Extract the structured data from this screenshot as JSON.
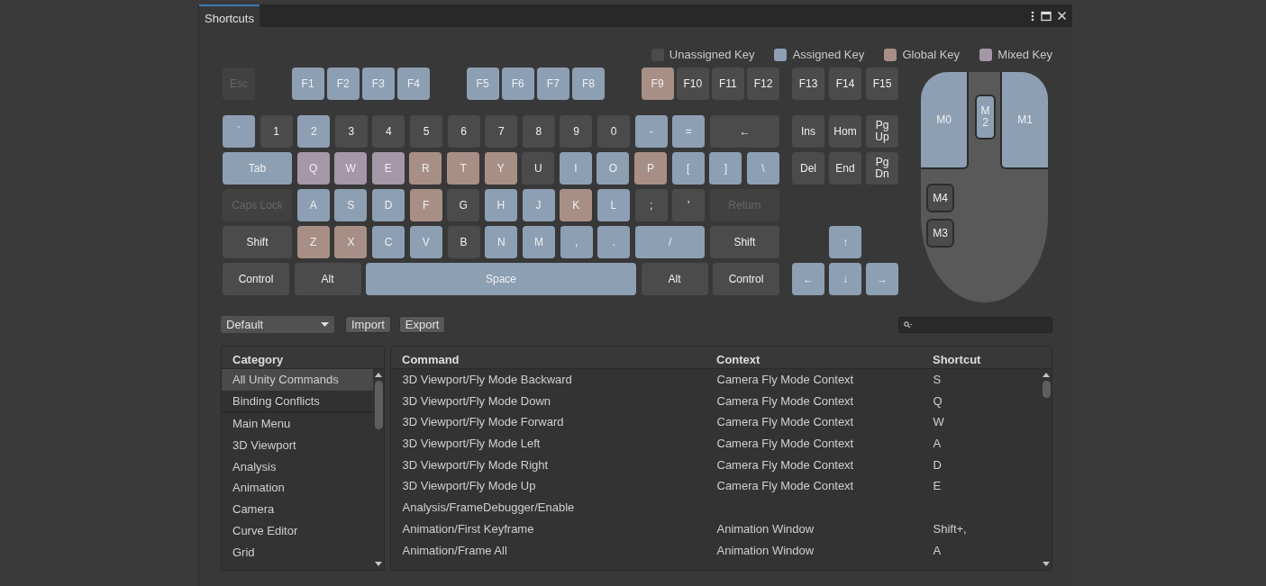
{
  "window": {
    "tab": "Shortcuts",
    "selected": true
  },
  "legend": [
    {
      "label": "Unassigned Key",
      "color": "#4b4b4b"
    },
    {
      "label": "Assigned Key",
      "color": "#8d9fb3"
    },
    {
      "label": "Global Key",
      "color": "#a88f85"
    },
    {
      "label": "Mixed Key",
      "color": "#a596a8"
    }
  ],
  "function_keys": [
    [
      {
        "label": "Esc",
        "kind": "key",
        "color": "#414141",
        "disabled": true
      }
    ],
    [
      {
        "label": "F1",
        "kind": "key",
        "color": "#8d9fb3",
        "disabled": false
      },
      {
        "label": "F2",
        "kind": "key",
        "color": "#8d9fb3",
        "disabled": false
      },
      {
        "label": "F3",
        "kind": "key",
        "color": "#8d9fb3",
        "disabled": false
      },
      {
        "label": "F4",
        "kind": "key",
        "color": "#8d9fb3",
        "disabled": false
      }
    ],
    [
      {
        "label": "F5",
        "kind": "key",
        "color": "#8d9fb3",
        "disabled": false
      },
      {
        "label": "F6",
        "kind": "key",
        "color": "#8d9fb3",
        "disabled": false
      },
      {
        "label": "F7",
        "kind": "key",
        "color": "#8d9fb3",
        "disabled": false
      },
      {
        "label": "F8",
        "kind": "key",
        "color": "#8d9fb3",
        "disabled": false
      }
    ],
    [
      {
        "label": "F9",
        "kind": "key",
        "color": "#a88f85",
        "disabled": false
      },
      {
        "label": "F10",
        "kind": "key",
        "color": "#4b4b4b",
        "disabled": false
      },
      {
        "label": "F11",
        "kind": "key",
        "color": "#4b4b4b",
        "disabled": false
      },
      {
        "label": "F12",
        "kind": "key",
        "color": "#4b4b4b",
        "disabled": false
      }
    ]
  ],
  "main_keys": [
    [
      {
        "label": "`",
        "kind": "key",
        "color": "#8d9fb3",
        "disabled": false
      },
      {
        "label": "1",
        "kind": "key",
        "color": "#4b4b4b",
        "disabled": false
      },
      {
        "label": "2",
        "kind": "key",
        "color": "#8d9fb3",
        "disabled": false
      },
      {
        "label": "3",
        "kind": "key",
        "color": "#4b4b4b",
        "disabled": false
      },
      {
        "label": "4",
        "kind": "key",
        "color": "#4b4b4b",
        "disabled": false
      },
      {
        "label": "5",
        "kind": "key",
        "color": "#4b4b4b",
        "disabled": false
      },
      {
        "label": "6",
        "kind": "key",
        "color": "#4b4b4b",
        "disabled": false
      },
      {
        "label": "7",
        "kind": "key",
        "color": "#4b4b4b",
        "disabled": false
      },
      {
        "label": "8",
        "kind": "key",
        "color": "#4b4b4b",
        "disabled": false
      },
      {
        "label": "9",
        "kind": "key",
        "color": "#4b4b4b",
        "disabled": false
      },
      {
        "label": "0",
        "kind": "key",
        "color": "#4b4b4b",
        "disabled": false
      },
      {
        "label": "-",
        "kind": "key",
        "color": "#8d9fb3",
        "disabled": false
      },
      {
        "label": "=",
        "kind": "key",
        "color": "#8d9fb3",
        "disabled": false
      },
      {
        "label": "←",
        "kind": "wide",
        "color": "#4b4b4b",
        "disabled": false
      }
    ],
    [
      {
        "label": "Tab",
        "kind": "wide",
        "color": "#8d9fb3",
        "disabled": false
      },
      {
        "label": "Q",
        "kind": "key",
        "color": "#a596a8",
        "disabled": false
      },
      {
        "label": "W",
        "kind": "key",
        "color": "#a596a8",
        "disabled": false
      },
      {
        "label": "E",
        "kind": "key",
        "color": "#a596a8",
        "disabled": false
      },
      {
        "label": "R",
        "kind": "key",
        "color": "#a88f85",
        "disabled": false
      },
      {
        "label": "T",
        "kind": "key",
        "color": "#a88f85",
        "disabled": false
      },
      {
        "label": "Y",
        "kind": "key",
        "color": "#a88f85",
        "disabled": false
      },
      {
        "label": "U",
        "kind": "key",
        "color": "#4b4b4b",
        "disabled": false
      },
      {
        "label": "I",
        "kind": "key",
        "color": "#8d9fb3",
        "disabled": false
      },
      {
        "label": "O",
        "kind": "key",
        "color": "#8d9fb3",
        "disabled": false
      },
      {
        "label": "P",
        "kind": "key",
        "color": "#a88f85",
        "disabled": false
      },
      {
        "label": "[",
        "kind": "key",
        "color": "#8d9fb3",
        "disabled": false
      },
      {
        "label": "]",
        "kind": "key",
        "color": "#8d9fb3",
        "disabled": false
      },
      {
        "label": "\\",
        "kind": "key",
        "color": "#8d9fb3",
        "disabled": false
      }
    ],
    [
      {
        "label": "Caps Lock",
        "kind": "wide",
        "color": "#414141",
        "disabled": true
      },
      {
        "label": "A",
        "kind": "key",
        "color": "#8d9fb3",
        "disabled": false
      },
      {
        "label": "S",
        "kind": "key",
        "color": "#8d9fb3",
        "disabled": false
      },
      {
        "label": "D",
        "kind": "key",
        "color": "#8d9fb3",
        "disabled": false
      },
      {
        "label": "F",
        "kind": "key",
        "color": "#a88f85",
        "disabled": false
      },
      {
        "label": "G",
        "kind": "key",
        "color": "#4b4b4b",
        "disabled": false
      },
      {
        "label": "H",
        "kind": "key",
        "color": "#8d9fb3",
        "disabled": false
      },
      {
        "label": "J",
        "kind": "key",
        "color": "#8d9fb3",
        "disabled": false
      },
      {
        "label": "K",
        "kind": "key",
        "color": "#a88f85",
        "disabled": false
      },
      {
        "label": "L",
        "kind": "key",
        "color": "#8d9fb3",
        "disabled": false
      },
      {
        "label": ";",
        "kind": "key",
        "color": "#4b4b4b",
        "disabled": false
      },
      {
        "label": "'",
        "kind": "key",
        "color": "#4b4b4b",
        "disabled": false
      },
      {
        "label": "Return",
        "kind": "wide",
        "color": "#414141",
        "disabled": true
      }
    ],
    [
      {
        "label": "Shift",
        "kind": "wide",
        "color": "#4b4b4b",
        "disabled": false
      },
      {
        "label": "Z",
        "kind": "key",
        "color": "#a88f85",
        "disabled": false
      },
      {
        "label": "X",
        "kind": "key",
        "color": "#a88f85",
        "disabled": false
      },
      {
        "label": "C",
        "kind": "key",
        "color": "#8d9fb3",
        "disabled": false
      },
      {
        "label": "V",
        "kind": "key",
        "color": "#8d9fb3",
        "disabled": false
      },
      {
        "label": "B",
        "kind": "key",
        "color": "#4b4b4b",
        "disabled": false
      },
      {
        "label": "N",
        "kind": "key",
        "color": "#8d9fb3",
        "disabled": false
      },
      {
        "label": "M",
        "kind": "key",
        "color": "#8d9fb3",
        "disabled": false
      },
      {
        "label": ",",
        "kind": "key",
        "color": "#8d9fb3",
        "disabled": false
      },
      {
        "label": ".",
        "kind": "key",
        "color": "#8d9fb3",
        "disabled": false
      },
      {
        "label": "/",
        "kind": "wide",
        "color": "#8d9fb3",
        "disabled": false
      },
      {
        "label": "Shift",
        "kind": "wide",
        "color": "#4b4b4b",
        "disabled": false
      }
    ],
    [
      {
        "label": "Control",
        "kind": "modifier",
        "color": "#4b4b4b",
        "disabled": false
      },
      {
        "label": "Alt",
        "kind": "modifier",
        "color": "#4b4b4b",
        "disabled": false
      },
      {
        "label": "Space",
        "kind": "space",
        "color": "#8d9fb3",
        "disabled": false
      },
      {
        "label": "Alt",
        "kind": "modifier",
        "color": "#4b4b4b",
        "disabled": false
      },
      {
        "label": "Control",
        "kind": "modifier",
        "color": "#4b4b4b",
        "disabled": false
      }
    ]
  ],
  "nav_keys": [
    [
      {
        "label": "F13",
        "color": "#4b4b4b",
        "disabled": false
      },
      {
        "label": "F14",
        "color": "#4b4b4b",
        "disabled": false
      },
      {
        "label": "F15",
        "color": "#4b4b4b",
        "disabled": false
      }
    ],
    [
      {
        "label": "Ins",
        "color": "#4b4b4b",
        "disabled": false
      },
      {
        "label": "Hom",
        "color": "#4b4b4b",
        "disabled": false
      },
      {
        "label": "Pg Up",
        "color": "#4b4b4b",
        "disabled": false
      }
    ],
    [
      {
        "label": "Del",
        "color": "#4b4b4b",
        "disabled": false
      },
      {
        "label": "End",
        "color": "#4b4b4b",
        "disabled": false
      },
      {
        "label": "Pg Dn",
        "color": "#4b4b4b",
        "disabled": false
      }
    ]
  ],
  "arrow_keys": [
    [
      {
        "label": "↑",
        "color": "#8d9fb3",
        "disabled": false
      }
    ],
    [
      {
        "label": "←",
        "color": "#8d9fb3",
        "disabled": false
      },
      {
        "label": "↓",
        "color": "#8d9fb3",
        "disabled": false
      },
      {
        "label": "→",
        "color": "#8d9fb3",
        "disabled": false
      }
    ]
  ],
  "mouse_buttons": [
    {
      "label": "M0",
      "kind": "left",
      "color": "#8d9fb3"
    },
    {
      "label": "M2",
      "kind": "middle",
      "color": "#8d9fb3"
    },
    {
      "label": "M1",
      "kind": "right",
      "color": "#8d9fb3"
    },
    {
      "label": "M4",
      "kind": "side",
      "color": "#4b4b4b"
    },
    {
      "label": "M3",
      "kind": "side",
      "color": "#4b4b4b"
    }
  ],
  "toolbar": {
    "profile": "Default",
    "buttons": [
      "Import",
      "Export"
    ]
  },
  "categories": {
    "title": "Category",
    "pinned": [
      {
        "label": "All Unity Commands",
        "selected": true
      },
      {
        "label": "Binding Conflicts",
        "selected": false
      }
    ],
    "items": [
      {
        "label": "Main Menu",
        "selected": false
      },
      {
        "label": "3D Viewport",
        "selected": false
      },
      {
        "label": "Analysis",
        "selected": false
      },
      {
        "label": "Animation",
        "selected": false
      },
      {
        "label": "Camera",
        "selected": false
      },
      {
        "label": "Curve Editor",
        "selected": false
      },
      {
        "label": "Grid",
        "selected": false
      }
    ]
  },
  "commands": {
    "columns": [
      "Command",
      "Context",
      "Shortcut"
    ],
    "rows": [
      {
        "command": "3D Viewport/Fly Mode Backward",
        "context": "Camera Fly Mode Context",
        "shortcut": "S"
      },
      {
        "command": "3D Viewport/Fly Mode Down",
        "context": "Camera Fly Mode Context",
        "shortcut": "Q"
      },
      {
        "command": "3D Viewport/Fly Mode Forward",
        "context": "Camera Fly Mode Context",
        "shortcut": "W"
      },
      {
        "command": "3D Viewport/Fly Mode Left",
        "context": "Camera Fly Mode Context",
        "shortcut": "A"
      },
      {
        "command": "3D Viewport/Fly Mode Right",
        "context": "Camera Fly Mode Context",
        "shortcut": "D"
      },
      {
        "command": "3D Viewport/Fly Mode Up",
        "context": "Camera Fly Mode Context",
        "shortcut": "E"
      },
      {
        "command": "Analysis/FrameDebugger/Enable"
      },
      {
        "command": "Animation/First Keyframe",
        "context": "Animation Window",
        "shortcut": "Shift+,"
      },
      {
        "command": "Animation/Frame All",
        "context": "Animation Window",
        "shortcut": "A"
      }
    ]
  }
}
